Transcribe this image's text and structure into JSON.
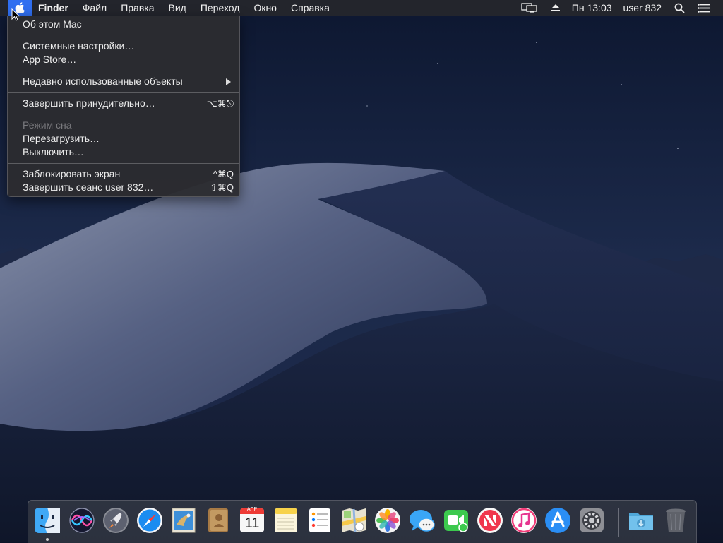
{
  "menubar": {
    "app_name": "Finder",
    "menus": [
      "Файл",
      "Правка",
      "Вид",
      "Переход",
      "Окно",
      "Справка"
    ],
    "clock": "Пн 13:03",
    "user": "user 832",
    "status_icons": [
      "display-mirroring-icon",
      "eject-icon",
      "spotlight-search-icon",
      "notification-center-icon"
    ]
  },
  "apple_menu": {
    "items": [
      {
        "label": "Об этом Mac",
        "shortcut": ""
      },
      {
        "label": "Системные настройки…",
        "shortcut": ""
      },
      {
        "label": "App Store…",
        "shortcut": ""
      },
      {
        "label": "Недавно использованные объекты",
        "shortcut": "",
        "submenu": true
      },
      {
        "label": "Завершить принудительно…",
        "shortcut": "⌥⌘⎋"
      },
      {
        "label": "Режим сна",
        "shortcut": "",
        "disabled": true
      },
      {
        "label": "Перезагрузить…",
        "shortcut": ""
      },
      {
        "label": "Выключить…",
        "shortcut": ""
      },
      {
        "label": "Заблокировать экран",
        "shortcut": "^⌘Q"
      },
      {
        "label": "Завершить сеанс user 832…",
        "shortcut": "⇧⌘Q"
      }
    ]
  },
  "dock": {
    "apps": [
      "finder",
      "siri",
      "launchpad",
      "safari",
      "mail",
      "contacts",
      "calendar",
      "notes",
      "reminders",
      "maps",
      "photos",
      "messages",
      "facetime",
      "news",
      "itunes",
      "app-store",
      "system-preferences",
      "downloads",
      "trash"
    ],
    "calendar": {
      "month": "АПР",
      "day": "11"
    }
  },
  "colors": {
    "menubar": "#2a2a2e",
    "apple_highlight": "#2f6ef0",
    "menu_bg": "#2c2c30",
    "wallpaper_sky": "#1a2747"
  }
}
